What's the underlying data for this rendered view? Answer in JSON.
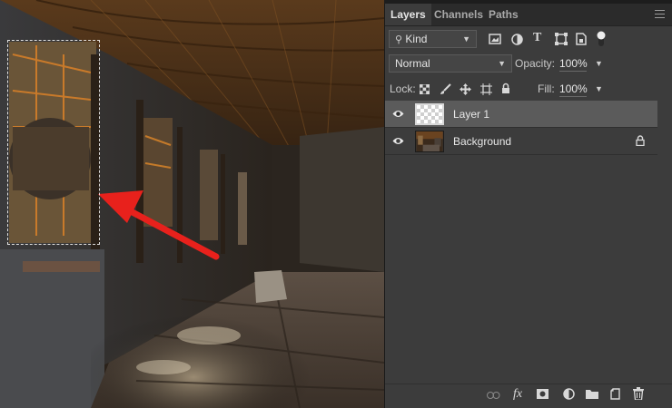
{
  "tabs": [
    {
      "label": "Layers"
    },
    {
      "label": "Channels"
    },
    {
      "label": "Paths"
    }
  ],
  "filter": {
    "kind_label": "Kind"
  },
  "blend": {
    "mode": "Normal"
  },
  "opacity": {
    "label": "Opacity:",
    "value": "100%"
  },
  "lock": {
    "label": "Lock:"
  },
  "fill": {
    "label": "Fill:",
    "value": "100%"
  },
  "layers": [
    {
      "name": "Layer 1",
      "selected": true
    },
    {
      "name": "Background",
      "locked": true
    }
  ],
  "bottom_bar": {
    "fx_label": "fx"
  },
  "colors": {
    "annotation_arrow": "#e8211c",
    "panel_bg": "#3c3c3c",
    "selected_row": "#5b5b5b"
  }
}
